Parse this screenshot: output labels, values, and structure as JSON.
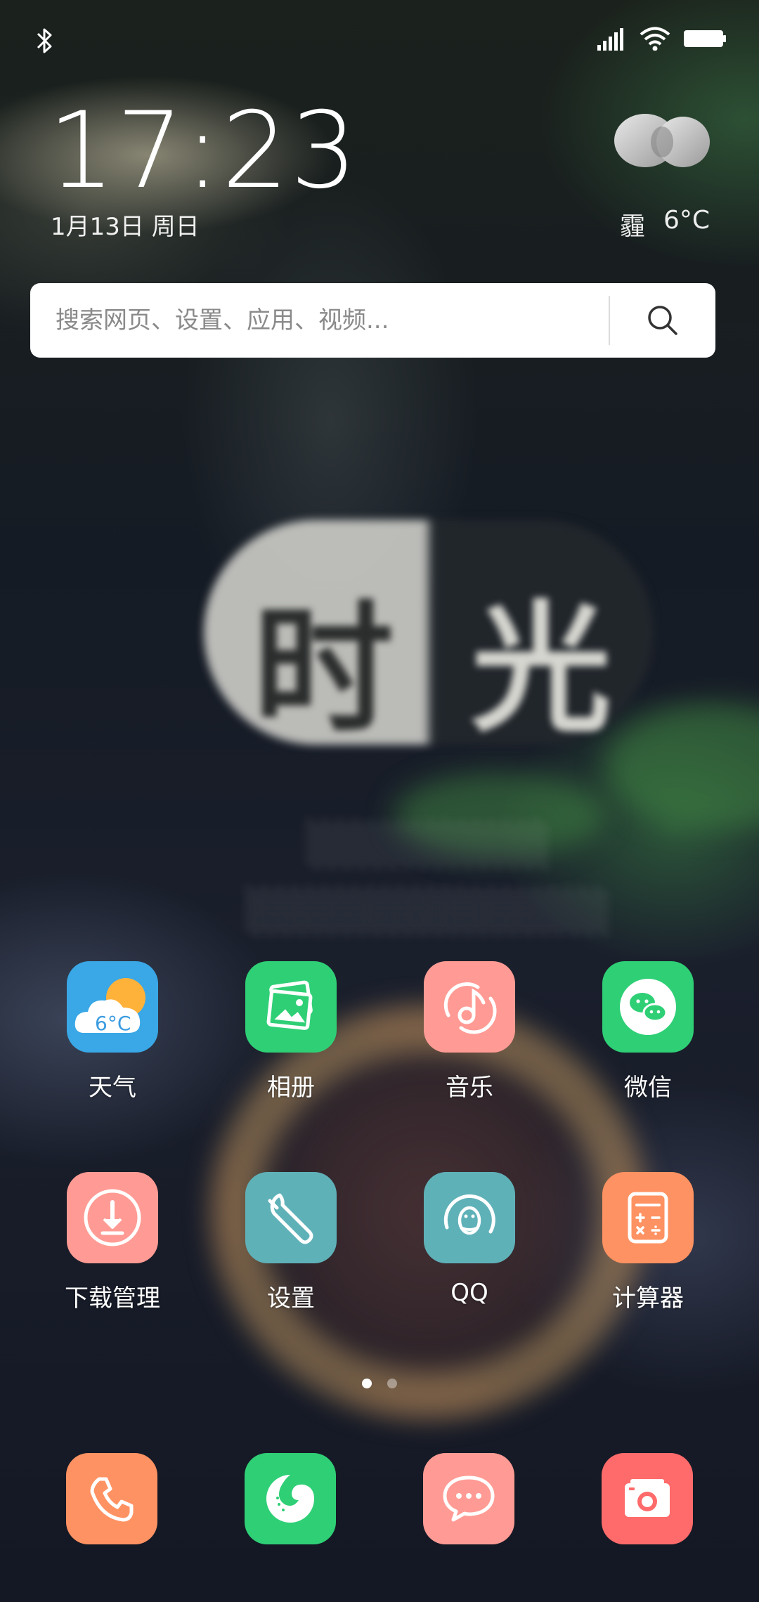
{
  "status_bar": {
    "bluetooth_icon": "bluetooth-icon",
    "signal_icon": "signal-icon",
    "wifi_icon": "wifi-icon",
    "battery_icon": "battery-icon"
  },
  "clock": {
    "time": "17:23",
    "date": "1月13日 周日"
  },
  "weather_widget": {
    "icon": "haze-icon",
    "condition": "霾",
    "temperature": "6°C"
  },
  "search": {
    "placeholder": "搜索网页、设置、应用、视频...",
    "button_icon": "search-icon"
  },
  "apps": [
    {
      "label": "天气",
      "icon": "weather-cloud-sun-icon",
      "color": "#3aa7e6",
      "tile_text": "6°C"
    },
    {
      "label": "相册",
      "icon": "gallery-photos-icon",
      "color": "#2fcf76"
    },
    {
      "label": "音乐",
      "icon": "music-note-icon",
      "color": "#ff9b94"
    },
    {
      "label": "微信",
      "icon": "wechat-icon",
      "color": "#2fcf76"
    },
    {
      "label": "下载管理",
      "icon": "download-icon",
      "color": "#ff9b94"
    },
    {
      "label": "设置",
      "icon": "wrench-icon",
      "color": "#5fb1b8"
    },
    {
      "label": "QQ",
      "icon": "qq-penguin-icon",
      "color": "#5fb1b8"
    },
    {
      "label": "计算器",
      "icon": "calculator-icon",
      "color": "#ff9262"
    }
  ],
  "pages": {
    "count": 2,
    "active": 1
  },
  "dock": [
    {
      "icon": "phone-icon",
      "color": "#ff9262"
    },
    {
      "icon": "browser-swirl-icon",
      "color": "#2fcf76"
    },
    {
      "icon": "messages-icon",
      "color": "#ff9b94"
    },
    {
      "icon": "camera-icon",
      "color": "#ff6b6b"
    }
  ]
}
